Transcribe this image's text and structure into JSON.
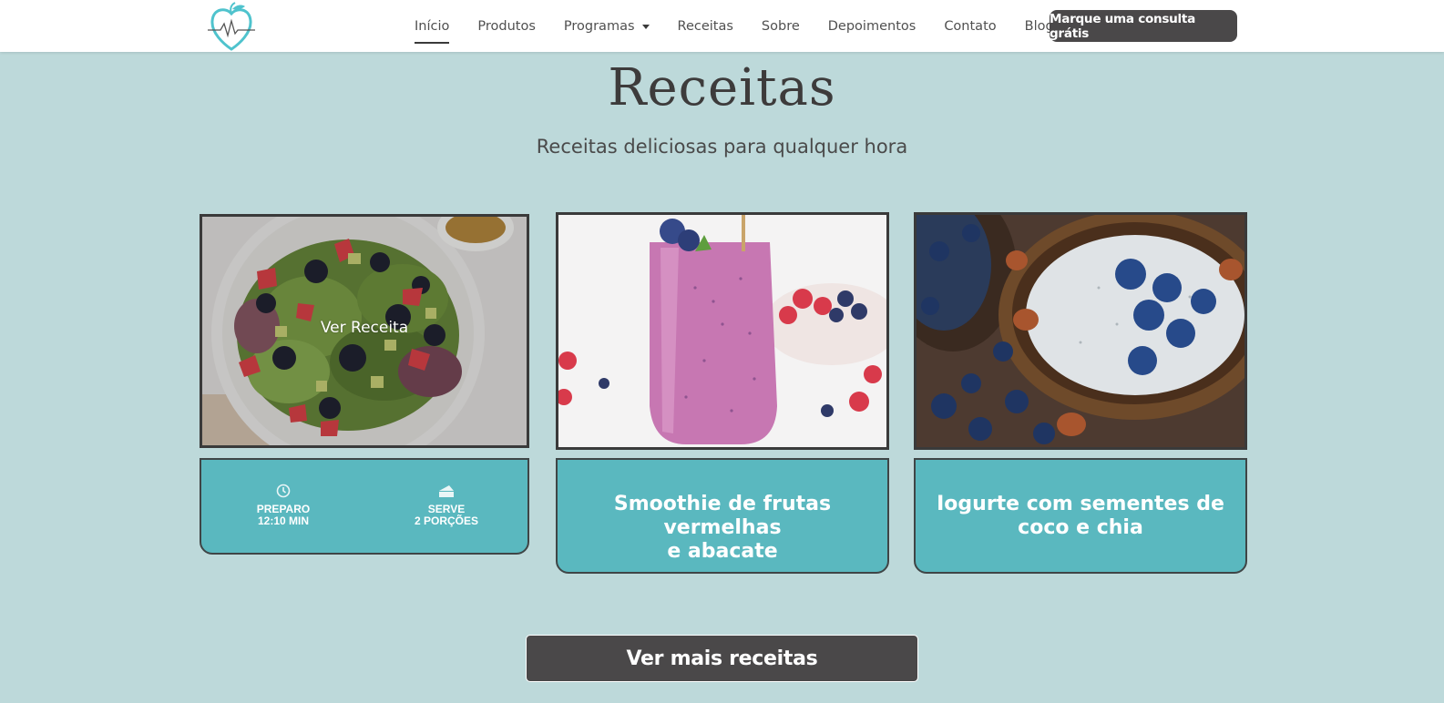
{
  "header": {
    "nav": [
      {
        "label": "Início",
        "active": true
      },
      {
        "label": "Produtos"
      },
      {
        "label": "Programas",
        "dropdown": true
      },
      {
        "label": "Receitas"
      },
      {
        "label": "Sobre"
      },
      {
        "label": "Depoimentos"
      },
      {
        "label": "Contato"
      },
      {
        "label": "Blog"
      }
    ],
    "cta_label": "Marque uma consulta grátis"
  },
  "main": {
    "title": "Receitas",
    "subtitle": "Receitas deliciosas para qualquer hora",
    "cards": [
      {
        "image": "salad-photo",
        "overlay_label": "Ver Receita",
        "prep_label": "PREPARO",
        "prep_value": "12:10 MIN",
        "serve_label": "SERVE",
        "serve_value": "2 PORÇÕES"
      },
      {
        "image": "smoothie-photo",
        "title_line1": "Smoothie de frutas vermelhas",
        "title_line2": "e abacate"
      },
      {
        "image": "chia-pudding-photo",
        "title_line1": "Iogurte com sementes de",
        "title_line2": "coco e chia"
      }
    ],
    "more_button": "Ver mais receitas"
  },
  "colors": {
    "background": "#bdd9da",
    "card_teal": "#5ab8bf",
    "dark_button": "#4a4849",
    "logo_teal": "#4fc3cd"
  }
}
